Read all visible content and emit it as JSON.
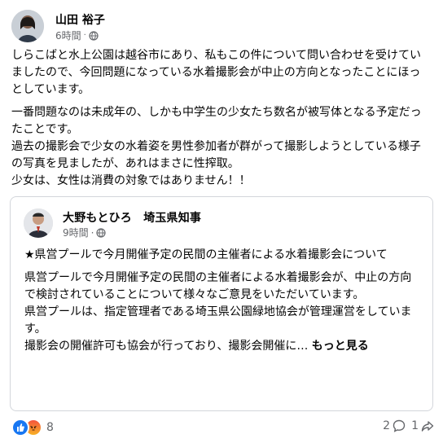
{
  "post": {
    "author": "山田 裕子",
    "time": "6時間",
    "dot": "·",
    "paragraphs": [
      "しらこばと水上公園は越谷市にあり、私もこの件について問い合わせを受けていましたので、今回問題になっている水着撮影会が中止の方向となったことにほっとしています。",
      "一番問題なのは未成年の、しかも中学生の少女たち数名が被写体となる予定だったことです。",
      "過去の撮影会で少女の水着姿を男性参加者が群がって撮影しようとしている様子の写真を見ましたが、あれはまさに性搾取。",
      "少女は、女性は消費の対象ではありません！！"
    ]
  },
  "shared": {
    "author": "大野もとひろ　埼玉県知事",
    "time": "9時間",
    "dot": "·",
    "paragraphs": [
      "★県営プールで今月開催予定の民間の主催者による水着撮影会について",
      "県営プールで今月開催予定の民間の主催者による水着撮影会が、中止の方向で検討されていることについて様々なご意見をいただいています。",
      "県営プールは、指定管理者である埼玉県公園緑地協会が管理運営をしています。",
      "撮影会の開催許可も協会が行っており、撮影会開催に…"
    ],
    "see_more": "もっと見る"
  },
  "footer": {
    "reaction_count": "8",
    "comments": "2",
    "shares": "1"
  },
  "icons": [
    "globe-icon",
    "like-icon",
    "angry-icon",
    "comment-icon",
    "share-icon"
  ]
}
